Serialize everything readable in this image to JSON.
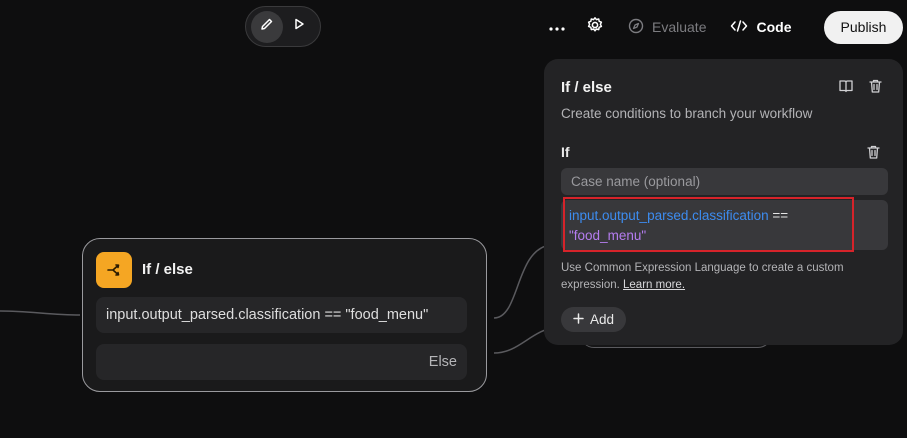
{
  "toolbar": {
    "more_icon": "more-dots-icon",
    "settings_icon": "gear-icon",
    "evaluate_label": "Evaluate",
    "evaluate_icon": "compass-icon",
    "code_label": "Code",
    "code_icon": "code-brackets-icon",
    "publish_label": "Publish"
  },
  "mode_toggle": {
    "edit_icon": "pencil-icon",
    "run_icon": "play-icon",
    "active": "edit"
  },
  "node": {
    "title": "If / else",
    "icon": "branch-icon",
    "icon_color": "#f5a623",
    "condition": "input.output_parsed.classification == \"food_menu\"",
    "else_label": "Else"
  },
  "panel": {
    "title": "If / else",
    "description": "Create conditions to branch your workflow",
    "section_label": "If",
    "case_name_placeholder": "Case name (optional)",
    "expression": {
      "variable": "input.output_parsed.classification",
      "operator": " ==",
      "value": "\"food_menu\""
    },
    "help_text": "Use Common Expression Language to create a custom expression.",
    "help_link": "Learn more.",
    "add_label": "Add"
  },
  "colors": {
    "accent_orange": "#f5a623",
    "variable_blue": "#3d8cf0",
    "string_purple": "#b57df0",
    "highlight_red": "#d6232a"
  }
}
